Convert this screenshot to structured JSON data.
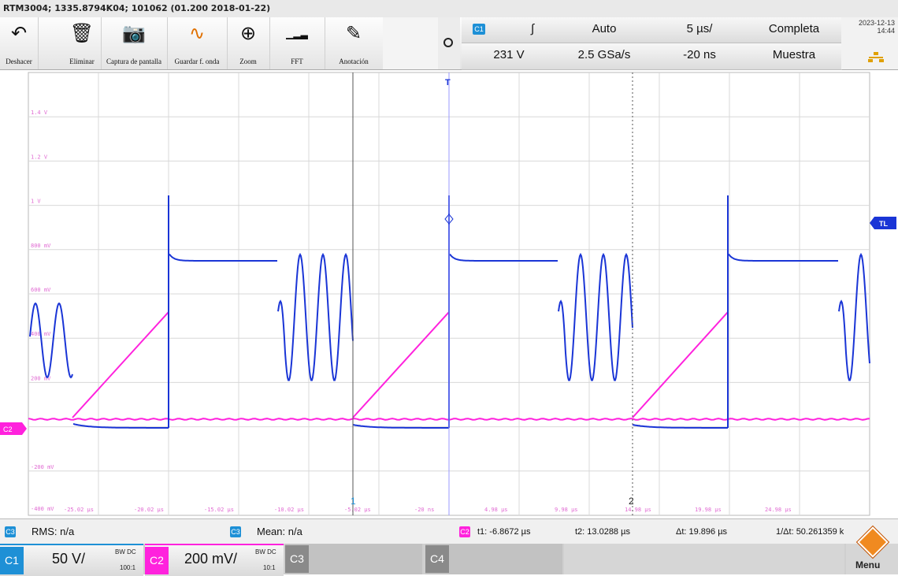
{
  "title_bar": {
    "text": "RTM3004; 1335.8794K04; 101062 (01.200 2018-01-22)"
  },
  "toolbar": {
    "tools": [
      {
        "label": "Deshacer",
        "icon": "undo-icon",
        "glyph": "↶"
      },
      {
        "label": "Eliminar",
        "icon": "trash-icon",
        "glyph": "🗑"
      },
      {
        "label": "Captura de pantalla",
        "icon": "camera-icon",
        "glyph": "📷"
      },
      {
        "label": "Guardar f. onda",
        "icon": "save-waveform-icon",
        "glyph": "∿"
      },
      {
        "label": "Zoom",
        "icon": "zoom-icon",
        "glyph": "⊕"
      },
      {
        "label": "FFT",
        "icon": "fft-icon",
        "glyph": "▁▂▃"
      },
      {
        "label": "Anotación",
        "icon": "pencil-icon",
        "glyph": "✎"
      }
    ]
  },
  "status": {
    "trigger_source": "C1",
    "trigger_slope": "∫",
    "trigger_level": "231 V",
    "trigger_mode": "Auto",
    "sample_rate": "2.5 GSa/s",
    "time_base": "5 µs/",
    "position": "-20 ns",
    "acquisition": "Completa",
    "acq_mode": "Muestra",
    "date": "2023-12-13",
    "time": "14:44",
    "colors": {
      "ch1": "#1a35d6",
      "ch2": "#ff22dd",
      "tag": "#1e90d6"
    }
  },
  "plot": {
    "y_labels": [
      "1.4 V",
      "1.2 V",
      "1 V",
      "800 mV",
      "600 mV",
      "400 mV",
      "200 mV",
      "-200 mV",
      "-400 mV"
    ],
    "x_labels": [
      "-25.02 µs",
      "-20.02 µs",
      "-15.02 µs",
      "-10.02 µs",
      "-5.02 µs",
      "-20 ns",
      "4.98 µs",
      "9.98 µs",
      "14.98 µs",
      "19.98 µs",
      "24.98 µs"
    ],
    "markers": {
      "trigger": "T",
      "trigger_level": "TL",
      "channel2": "C2",
      "cursor1": "1",
      "cursor2": "2"
    }
  },
  "measurements": {
    "rms": "RMS: n/a",
    "mean": "Mean: n/a",
    "t1": "t1: -6.8672 µs",
    "t2": "t2: 13.0288 µs",
    "dt": "Δt: 19.896 µs",
    "inv_dt": "1/Δt: 50.261359 k"
  },
  "channels": {
    "c1": {
      "tag": "C1",
      "scale": "50 V/",
      "coupling": "BW DC",
      "probe": "100:1"
    },
    "c2": {
      "tag": "C2",
      "scale": "200 mV/",
      "coupling": "BW DC",
      "probe": "10:1"
    },
    "c3": {
      "tag": "C3"
    },
    "c4": {
      "tag": "C4"
    },
    "menu": "Menu"
  }
}
